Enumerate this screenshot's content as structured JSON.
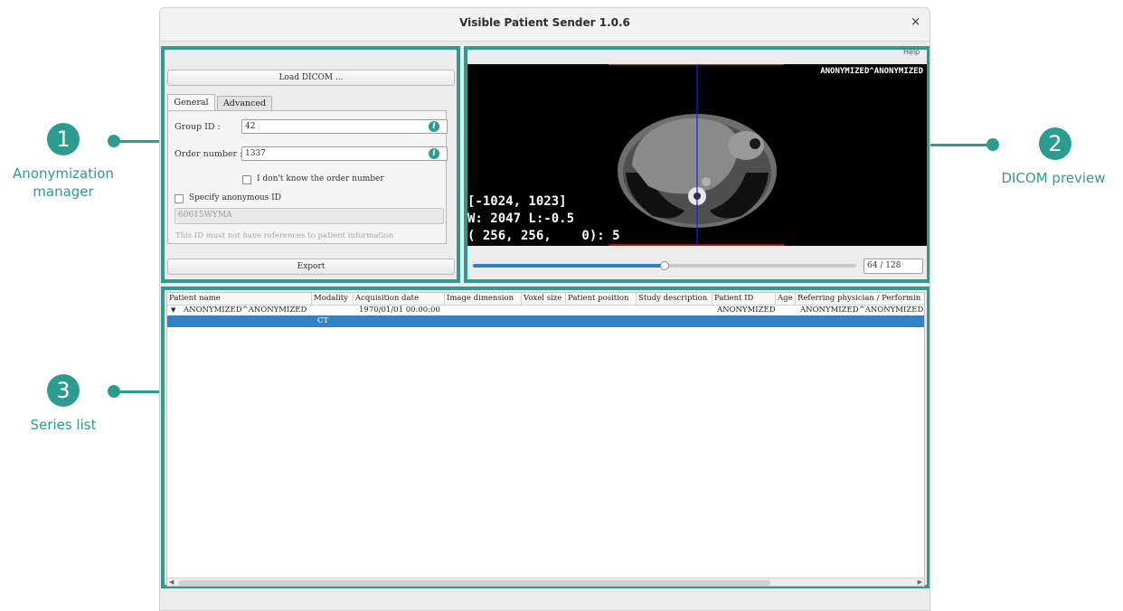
{
  "window": {
    "title": "Visible Patient Sender 1.0.6",
    "close_label": "×"
  },
  "annotations": [
    {
      "number": "1",
      "label": "Anonymization manager"
    },
    {
      "number": "2",
      "label": "DICOM preview"
    },
    {
      "number": "3",
      "label": "Series list"
    }
  ],
  "anonymization": {
    "load_button": "Load DICOM ...",
    "tabs": [
      {
        "label": "General"
      },
      {
        "label": "Advanced"
      }
    ],
    "group_id_label": "Group ID :",
    "group_id_value": "42",
    "order_number_label": "Order number :",
    "order_number_value": "1337",
    "dont_know_label": "I don't know the order number",
    "specify_id_label": "Specify anonymous ID",
    "anonymous_id_value": "60615WYMA",
    "hint": "This ID must not have references to patient information",
    "export_button": "Export"
  },
  "preview": {
    "help_label": "Help",
    "patient_overlay": "ANONYMIZED^ANONYMIZED",
    "range_text": "[-1024, 1023]",
    "window_level_text": "W: 2047 L:-0.5",
    "pixel_text": "( 256, 256,    0): 5",
    "slice_value": "64 / 128",
    "slice_index": 64,
    "slice_count": 128
  },
  "series_list": {
    "columns": [
      "Patient name",
      "Modality",
      "Acquisition date",
      "Image dimension",
      "Voxel size",
      "Patient position",
      "Study description",
      "Patient ID",
      "Age",
      "Referring physician / Performin"
    ],
    "rows": [
      {
        "patient_name": "ANONYMIZED^ANONYMIZED",
        "acquisition_date": "1970/01/01 00:00:00",
        "patient_id": "ANONYMIZED",
        "physician": "ANONYMIZED^ANONYMIZED"
      },
      {
        "modality": "CT"
      }
    ]
  },
  "colors": {
    "accent": "#2e9b8f",
    "selection": "#2f84c9",
    "slider": "#2f7fc7"
  }
}
